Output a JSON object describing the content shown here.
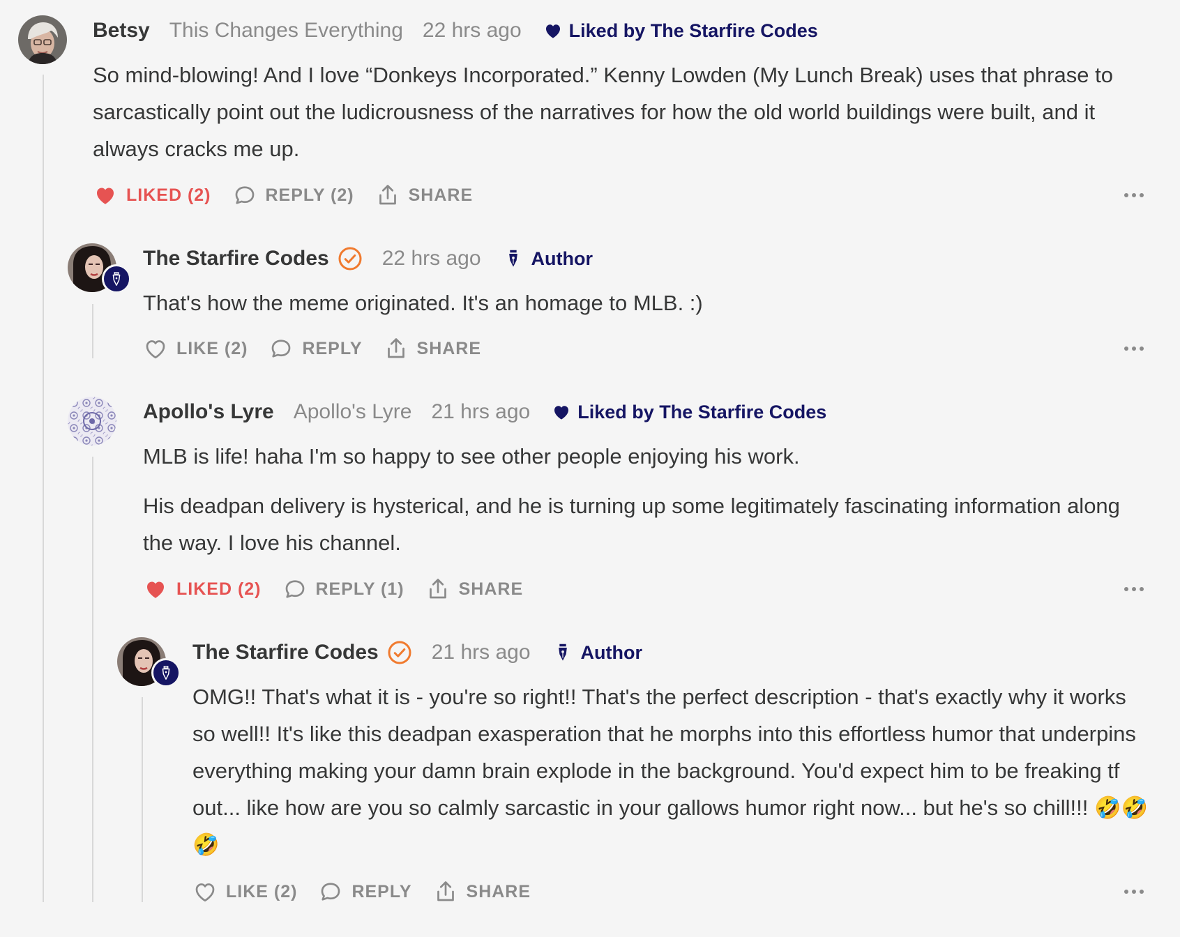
{
  "colors": {
    "author_navy": "#151563",
    "liked_red": "#e65352",
    "muted": "#8a8a8a",
    "verified_orange": "#f07a2e"
  },
  "comments": [
    {
      "name": "Betsy",
      "publication": "This Changes Everything",
      "time": "22 hrs ago",
      "liked_by": "Liked by The Starfire Codes",
      "paragraphs": [
        "So mind-blowing! And I love “Donkeys Incorporated.” Kenny Lowden (My Lunch Break) uses that phrase to sarcastically point out the ludicrousness of the narratives for how the old world buildings were built, and it always cracks me up."
      ],
      "like_label": "LIKED (2)",
      "reply_label": "REPLY (2)",
      "share_label": "SHARE"
    },
    {
      "name": "The Starfire Codes",
      "time": "22 hrs ago",
      "author_label": "Author",
      "paragraphs": [
        "That's how the meme originated. It's an homage to MLB. :)"
      ],
      "like_label": "LIKE (2)",
      "reply_label": "REPLY",
      "share_label": "SHARE"
    },
    {
      "name": "Apollo's Lyre",
      "publication": "Apollo's Lyre",
      "time": "21 hrs ago",
      "liked_by": "Liked by The Starfire Codes",
      "paragraphs": [
        "MLB is life! haha I'm so happy to see other people enjoying his work.",
        "His deadpan delivery is hysterical, and he is turning up some legitimately fascinating information along the way. I love his channel."
      ],
      "like_label": "LIKED (2)",
      "reply_label": "REPLY (1)",
      "share_label": "SHARE"
    },
    {
      "name": "The Starfire Codes",
      "time": "21 hrs ago",
      "author_label": "Author",
      "paragraphs": [
        "OMG!! That's what it is - you're so right!! That's the perfect description - that's exactly why it works so well!! It's like this deadpan exasperation that he morphs into this effortless humor that underpins everything making your damn brain explode in the background. You'd expect him to be freaking tf out... like how are you so calmly sarcastic in your gallows humor right now... but he's so chill!!! 🤣🤣🤣"
      ],
      "like_label": "LIKE (2)",
      "reply_label": "REPLY",
      "share_label": "SHARE"
    }
  ]
}
